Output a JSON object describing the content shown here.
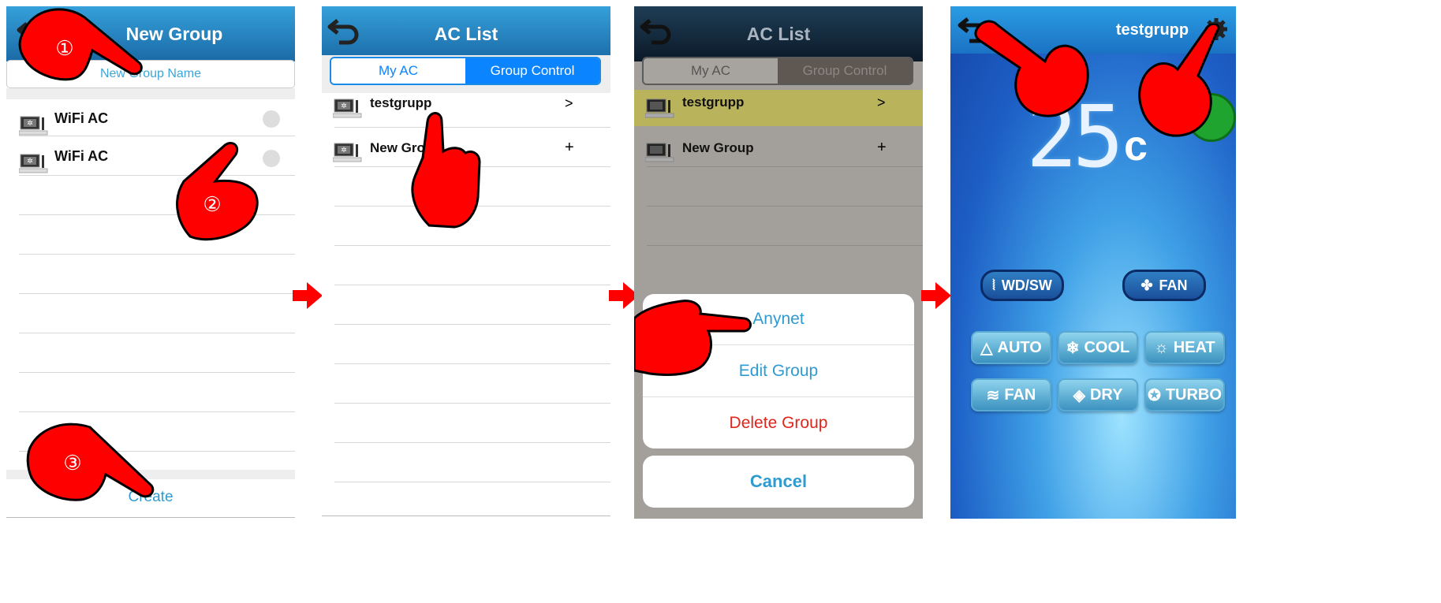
{
  "screen1": {
    "title": "New Group",
    "name_placeholder": "New Group Name",
    "devices": [
      {
        "label": "WiFi AC"
      },
      {
        "label": "WiFi AC"
      }
    ],
    "create_label": "Create",
    "step_labels": [
      "①",
      "②",
      "③"
    ]
  },
  "screen2": {
    "title": "AC List",
    "tabs": [
      "My AC",
      "Group Control"
    ],
    "groups": [
      {
        "label": "testgrupp",
        "action": ">"
      },
      {
        "label": "New Group",
        "action": "+"
      }
    ]
  },
  "screen3": {
    "title": "AC List",
    "tabs": [
      "My AC",
      "Group Control"
    ],
    "groups": [
      {
        "label": "testgrupp",
        "action": ">"
      },
      {
        "label": "New Group",
        "action": "+"
      }
    ],
    "sheet": {
      "options": [
        "Anynet",
        "Edit Group",
        "Delete Group"
      ],
      "cancel": "Cancel"
    }
  },
  "screen4": {
    "title": "testgrupp",
    "temperature": "25",
    "unit": "c",
    "swing_label": "WD/SW",
    "fan_label": "FAN",
    "modes": [
      "AUTO",
      "COOL",
      "HEAT",
      "FAN",
      "DRY",
      "TURBO"
    ]
  },
  "colors": {
    "header": "#2a86c8",
    "link": "#2f9bd0",
    "delete": "#e0261b",
    "selected_tab": "#0a84ff",
    "hand": "#ff0000"
  }
}
